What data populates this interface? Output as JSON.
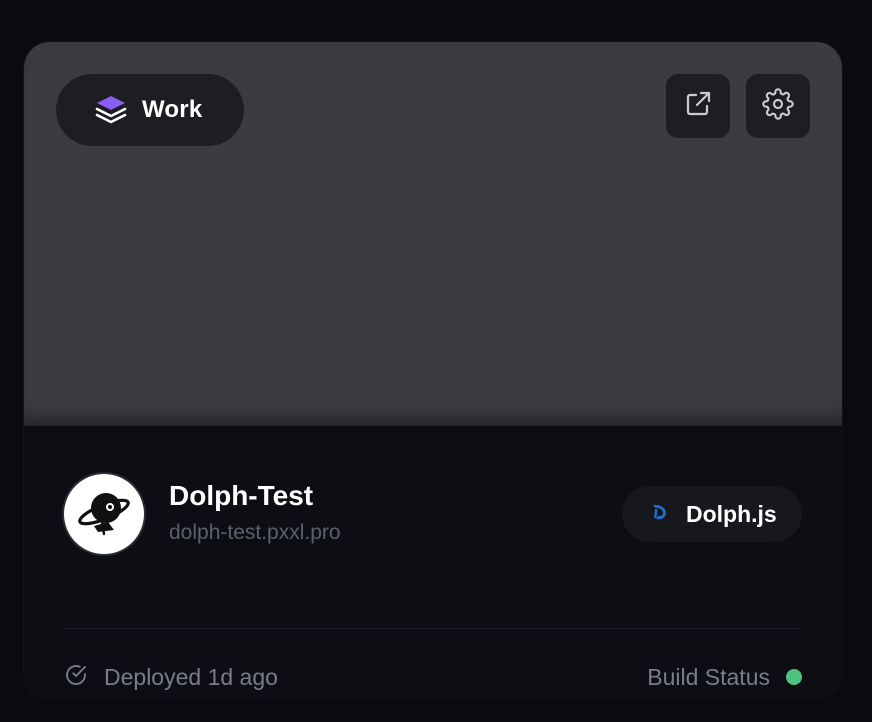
{
  "workspace": {
    "label": "Work",
    "icon": "layers-icon",
    "accent": "#8b5cf6"
  },
  "toolbar": {
    "external_icon": "external-link-icon",
    "settings_icon": "gear-icon"
  },
  "project": {
    "name": "Dolph-Test",
    "domain": "dolph-test.pxxl.pro",
    "avatar_icon": "planet-astronaut-icon"
  },
  "framework": {
    "label": "Dolph.js",
    "icon": "dolph-logo-icon",
    "color": "#1e88e5"
  },
  "deployment": {
    "text": "Deployed 1d ago",
    "icon": "check-circle-icon"
  },
  "build": {
    "label": "Build Status",
    "status_color": "#4fc07e"
  }
}
